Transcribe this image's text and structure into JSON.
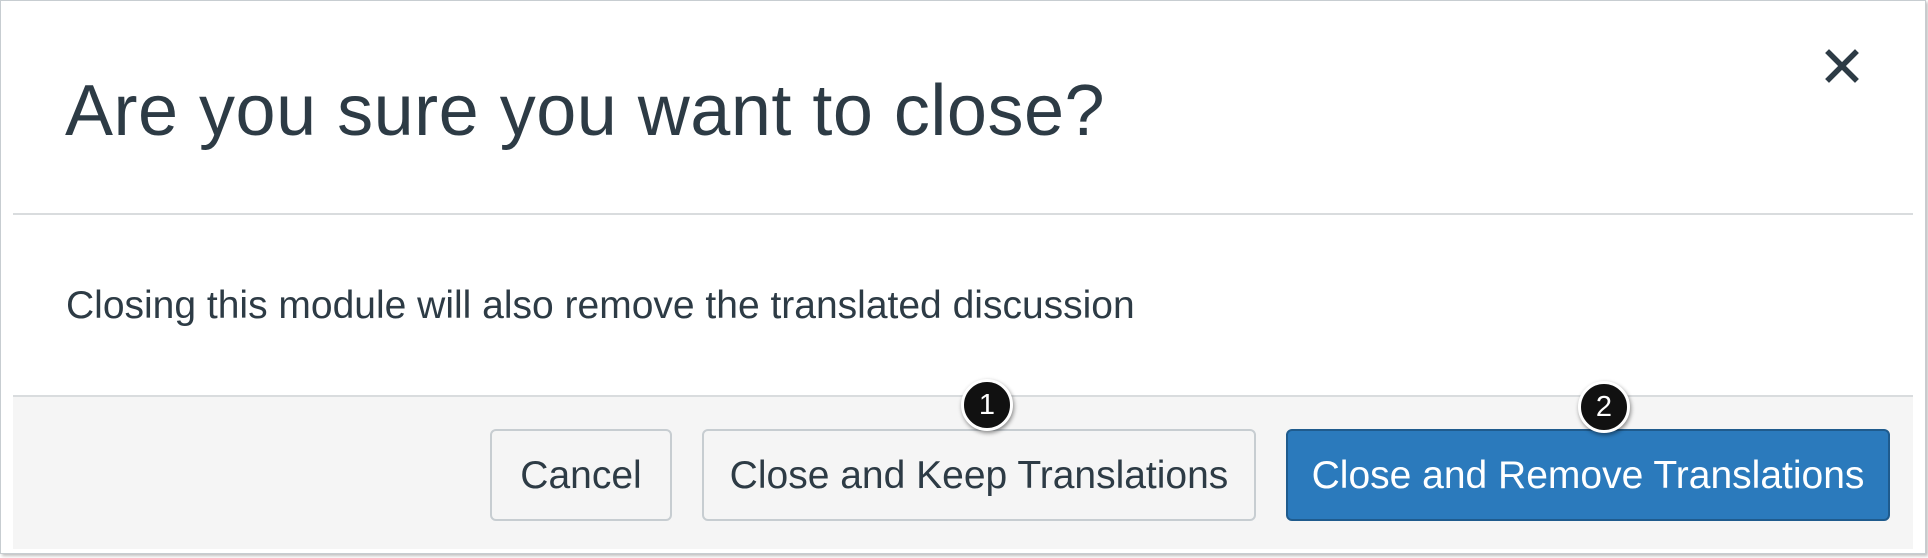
{
  "dialog": {
    "title": "Are you sure you want to close?",
    "close_icon": "close-icon",
    "message": "Closing this module will also remove the translated discussion"
  },
  "buttons": {
    "cancel_label": "Cancel",
    "keep_label": "Close and Keep Translations",
    "remove_label": "Close and Remove Translations"
  },
  "callouts": [
    {
      "number": "1"
    },
    {
      "number": "2"
    }
  ],
  "colors": {
    "primary": "#2b7abc",
    "text": "#2d3b45",
    "footer_bg": "#f5f5f5",
    "marker": "#111111"
  }
}
